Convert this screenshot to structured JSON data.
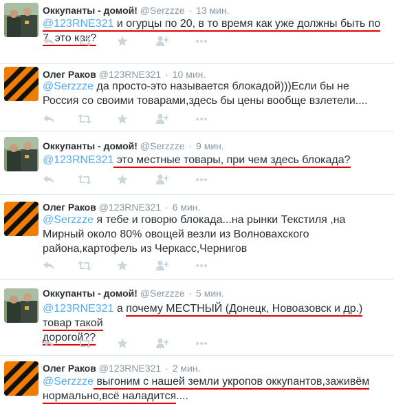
{
  "tweets": [
    {
      "name": "Оккупанты - домой!",
      "handle": "@Serzzze",
      "time": "13 мин.",
      "avatar": "man-avatar",
      "text_parts": [
        "@123RNE321",
        " и огурцы по 20, в то время как уже должны быть по 7, это как?"
      ]
    },
    {
      "name": "Олег Раков",
      "handle": "@123RNE321",
      "time": "10 мин.",
      "avatar": "ribbon-avatar",
      "text_parts": [
        "@Serzzze",
        " да просто-это называется блокадой)))Если бы не Россия со своими товарами,здесь бы цены вообще взлетели...."
      ]
    },
    {
      "name": "Оккупанты - домой!",
      "handle": "@Serzzze",
      "time": "9 мин.",
      "avatar": "man-avatar",
      "text_parts": [
        "@123RNE321",
        " это местные товары, при чем здесь блокада?"
      ]
    },
    {
      "name": "Олег Раков",
      "handle": "@123RNE321",
      "time": "6 мин.",
      "avatar": "ribbon-avatar",
      "text_parts": [
        "@Serzzze",
        " я тебе и говорю блокада...на рынки Текстиля ,на Мирный около 80% овощей везли из Волновахского района,картофель из Черкасс,Чернигов"
      ]
    },
    {
      "name": "Оккупанты - домой!",
      "handle": "@Serzzze",
      "time": "5 мин.",
      "avatar": "man-avatar",
      "text_parts": [
        "@123RNE321",
        " а ",
        "почему МЕСТНЫЙ (Донецк, Новоазовск и др.) товар такой",
        "дорогой??"
      ]
    },
    {
      "name": "Олег Раков",
      "handle": "@123RNE321",
      "time": "2 мин.",
      "avatar": "ribbon-avatar",
      "text_parts": [
        "@Serzzze",
        " выгоним с нашей земли укропов оккупантов,заживём",
        "нормально,всё наладится",
        "...."
      ]
    }
  ],
  "separator": "·",
  "action_icons": [
    "reply-icon",
    "retweet-icon",
    "favorite-icon",
    "follow-icon",
    "more-icon"
  ],
  "colors": {
    "mention": "#55acee",
    "underline": "#e00000",
    "muted": "#8899a6",
    "icon": "#ccd6dd",
    "ribbon_orange": "#f07d00",
    "ribbon_black": "#111111"
  }
}
